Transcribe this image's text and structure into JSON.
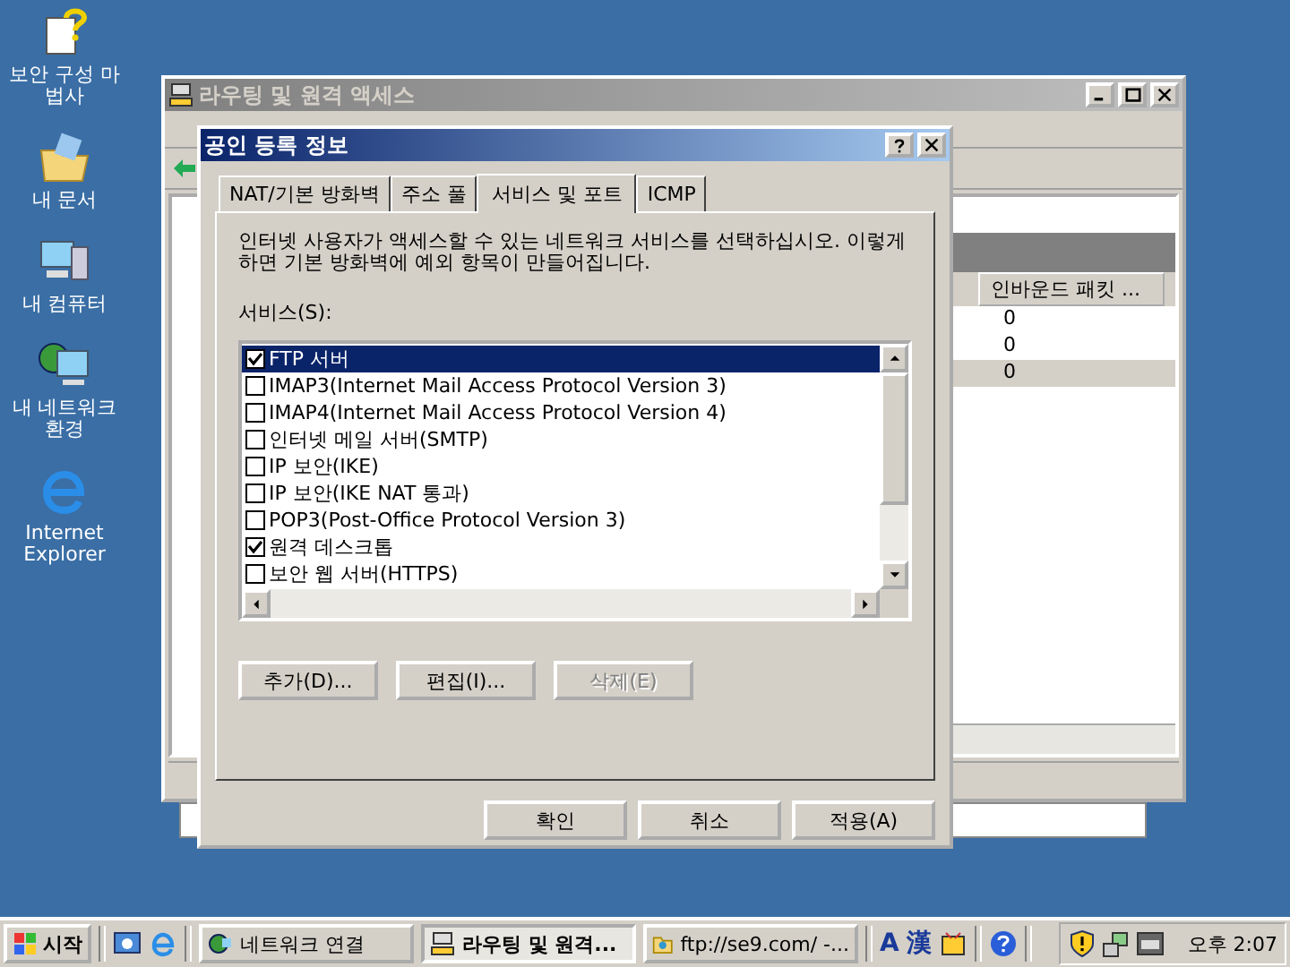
{
  "desktop_icons": [
    {
      "label": "보안 구성 마법사",
      "kind": "wizard"
    },
    {
      "label": "내 문서",
      "kind": "documents"
    },
    {
      "label": "내 컴퓨터",
      "kind": "computer"
    },
    {
      "label": "내 네트워크 환경",
      "kind": "network"
    },
    {
      "label": "Internet Explorer",
      "kind": "browser"
    }
  ],
  "background_window": {
    "title": "라우팅 및 원격 액세스",
    "columns": [
      "인바운드 패킷 ..."
    ],
    "rows": [
      {
        "value": "0",
        "selected": false
      },
      {
        "value": "0",
        "selected": false
      },
      {
        "value": "0",
        "selected": true
      }
    ]
  },
  "dialog": {
    "title": "공인 등록 정보",
    "tabs": [
      {
        "label": "NAT/기본 방화벽",
        "selected": false
      },
      {
        "label": "주소 풀",
        "selected": false
      },
      {
        "label": "서비스 및 포트",
        "selected": true
      },
      {
        "label": "ICMP",
        "selected": false
      }
    ],
    "description": "인터넷 사용자가 액세스할 수 있는 네트워크 서비스를 선택하십시오. 이렇게 하면 기본 방화벽에 예외 항목이 만들어집니다.",
    "list_label": "서비스(S):",
    "services": [
      {
        "label": "FTP 서버",
        "checked": true,
        "selected": true
      },
      {
        "label": "IMAP3(Internet Mail Access Protocol Version 3)",
        "checked": false,
        "selected": false
      },
      {
        "label": "IMAP4(Internet Mail Access Protocol Version 4)",
        "checked": false,
        "selected": false
      },
      {
        "label": "인터넷 메일 서버(SMTP)",
        "checked": false,
        "selected": false
      },
      {
        "label": "IP 보안(IKE)",
        "checked": false,
        "selected": false
      },
      {
        "label": "IP 보안(IKE NAT 통과)",
        "checked": false,
        "selected": false
      },
      {
        "label": "POP3(Post-Office Protocol Version 3)",
        "checked": false,
        "selected": false
      },
      {
        "label": "원격 데스크톱",
        "checked": true,
        "selected": false
      },
      {
        "label": "보안 웹 서버(HTTPS)",
        "checked": false,
        "selected": false
      }
    ],
    "actions": [
      {
        "label": "추가(D)...",
        "disabled": false
      },
      {
        "label": "편집(I)...",
        "disabled": false
      },
      {
        "label": "삭제(E)",
        "disabled": true
      }
    ],
    "buttons": [
      "확인",
      "취소",
      "적용(A)"
    ]
  },
  "taskbar": {
    "start": "시작",
    "tasks": [
      {
        "label": "네트워크 연결",
        "kind": "network",
        "selected": false
      },
      {
        "label": "라우팅 및 원격...",
        "kind": "routing",
        "selected": true
      },
      {
        "label": "ftp://se9.com/ -...",
        "kind": "folder",
        "selected": false
      }
    ],
    "language": [
      "A",
      "漢"
    ],
    "clock": "오후 2:07"
  }
}
